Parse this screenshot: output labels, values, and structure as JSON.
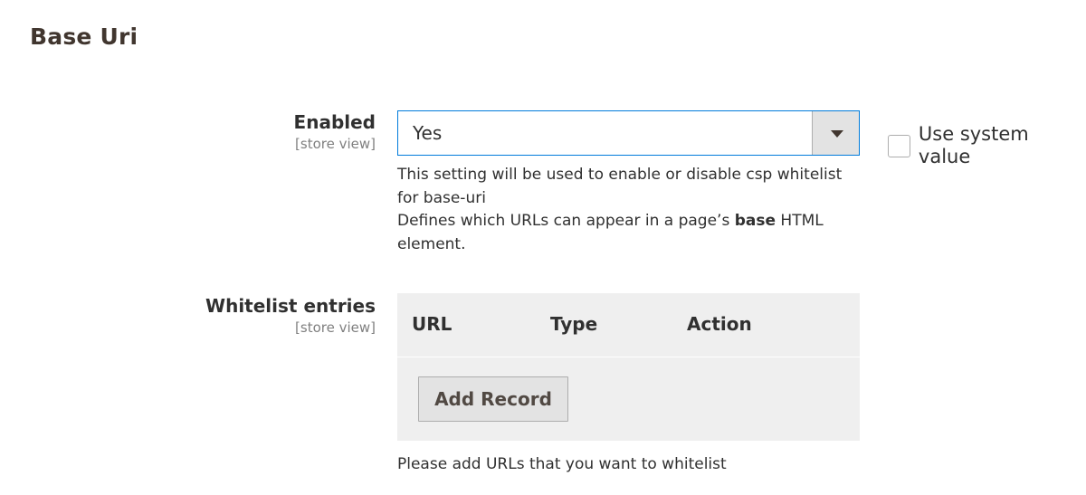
{
  "section": {
    "title": "Base Uri"
  },
  "enabled": {
    "label": "Enabled",
    "scope": "[store view]",
    "selected": "Yes",
    "use_system_value": "Use system value",
    "note_line1": "This setting will be used to enable or disable csp whitelist for base-uri",
    "note_line2_pre": "Defines which URLs can appear in a page’s ",
    "note_line2_bold": "base",
    "note_line2_post": " HTML element."
  },
  "whitelist": {
    "label": "Whitelist entries",
    "scope": "[store view]",
    "columns": [
      "URL",
      "Type",
      "Action"
    ],
    "add_button": "Add Record",
    "hint": "Please add URLs that you want to whitelist"
  },
  "colors": {
    "focus_border": "#007bdb",
    "grid_bg": "#efefef",
    "button_bg": "#e3e3e3"
  },
  "icons": {
    "select_arrow": "triangle-down-icon"
  }
}
